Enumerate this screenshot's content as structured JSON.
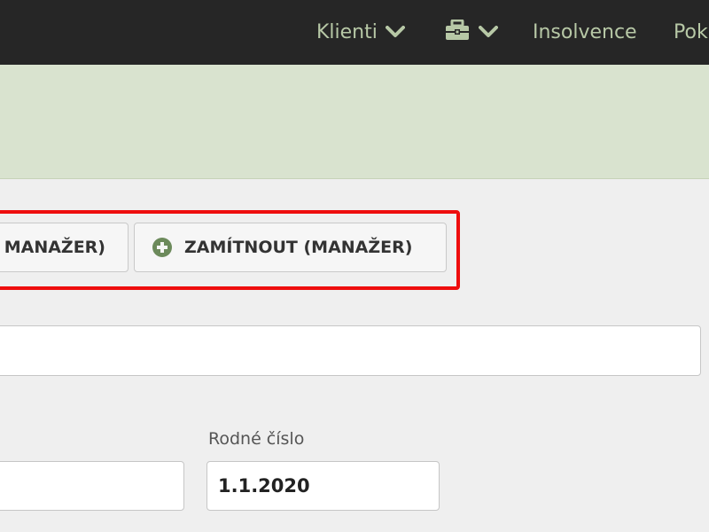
{
  "navbar": {
    "clients_label": "Klienti",
    "toolbox_icon": "toolbox-icon",
    "insolvence_label": "Insolvence",
    "overflow_label": "Pok"
  },
  "actions": {
    "approve_label": "MANAŽER)",
    "reject_label": "ZAMÍTNOUT (MANAŽER)",
    "highlight_color": "#ee0d0d"
  },
  "form": {
    "rodne_cislo_label": "Rodné číslo",
    "rodne_cislo_value": "1.1.2020"
  },
  "colors": {
    "navbar_bg": "#262626",
    "nav_text": "#b7c8a6",
    "banner_bg": "#d9e3cf",
    "icon_green": "#6c8a5b"
  }
}
